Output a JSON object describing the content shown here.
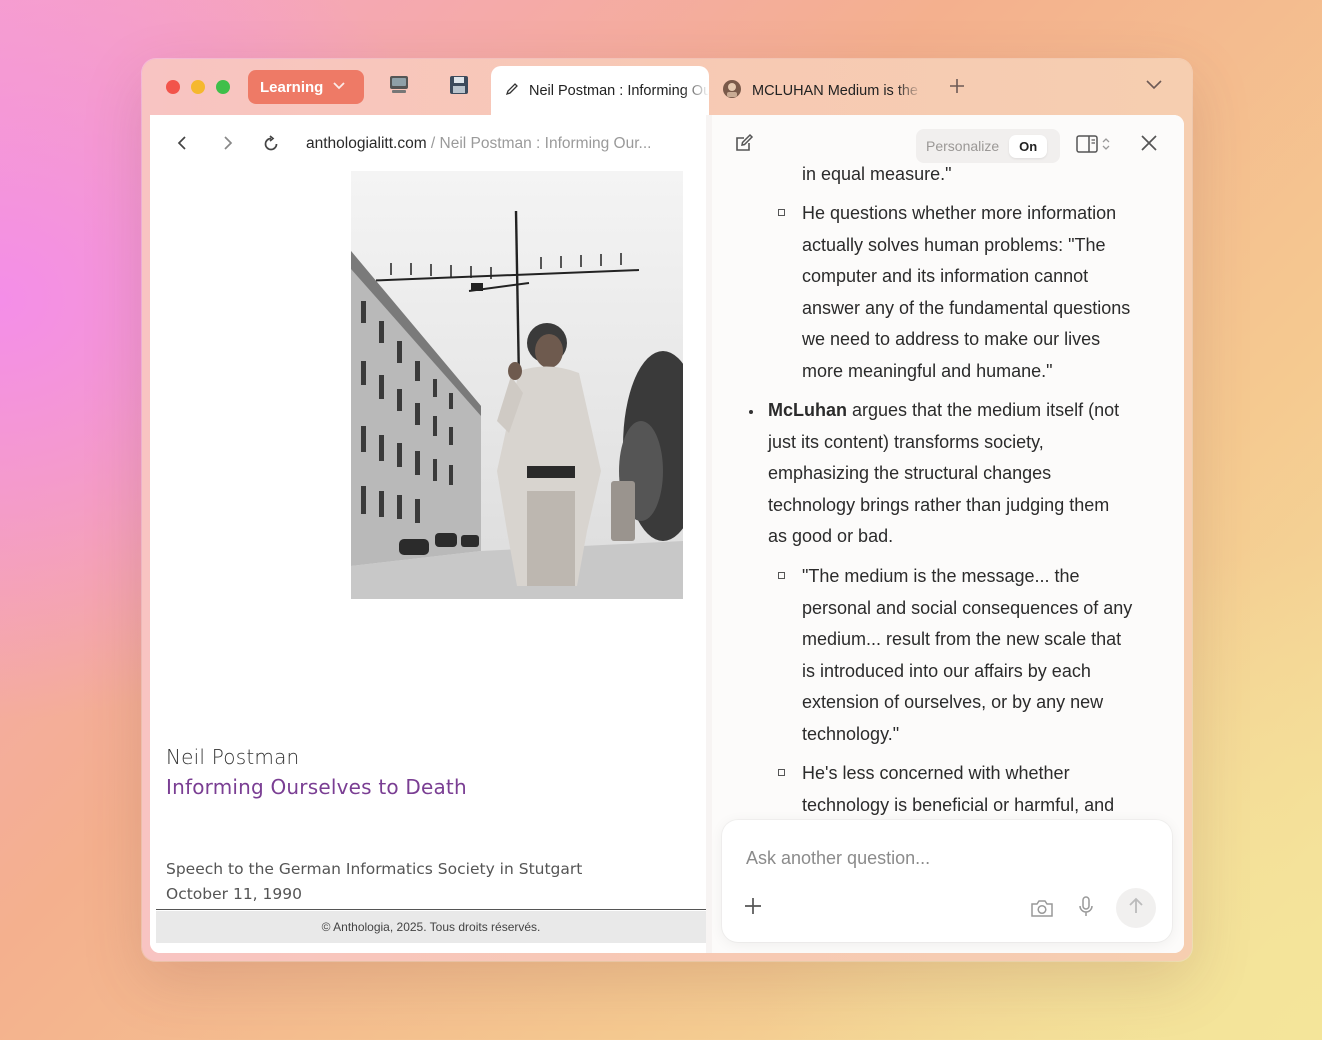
{
  "window": {
    "space_label": "Learning",
    "tabs": [
      {
        "title": "Neil Postman : Informing Ourselves to Death",
        "active": true,
        "icon": "pencil-icon"
      },
      {
        "title": "MCLUHAN Medium is the message",
        "active": false,
        "icon": "mcluhan-favicon"
      }
    ],
    "pinned_icons": [
      "computer-icon",
      "floppy-disk-icon"
    ]
  },
  "address_bar": {
    "host": "anthologialitt.com",
    "path": " / Neil Postman : Informing Our..."
  },
  "page": {
    "author": "Neil Postman",
    "title": "Informing Ourselves to Death",
    "speech_line1": "Speech to the German Informatics Society in Stutgart",
    "speech_line2": "October 11, 1990",
    "footer": "© Anthologia, 2025. Tous droits réservés.",
    "accent_color": "#7a3e93"
  },
  "assistant": {
    "personalize_label": "Personalize",
    "personalize_state": "On",
    "lines": {
      "l0": "in equal measure.\"",
      "s1": [
        "He questions whether more information",
        "actually solves human problems: \"The",
        "computer and its information cannot",
        "answer any of the fundamental questions",
        "we need to address to make our lives",
        "more meaningful and humane.\""
      ],
      "m1_bold": "McLuhan",
      "m1": [
        " argues that the medium itself (not",
        "just its content) transforms society,",
        "emphasizing the structural changes",
        "technology brings rather than judging them",
        "as good or bad."
      ],
      "s2": [
        "\"The medium is the message... the",
        "personal and social consequences of any",
        "medium... result from the new scale that",
        "is introduced into our affairs by each",
        "extension of ourselves, or by any new",
        "technology.\""
      ],
      "s3": [
        "He's less concerned with whether",
        "technology is beneficial or harmful, and"
      ]
    },
    "input_placeholder": "Ask another question..."
  }
}
